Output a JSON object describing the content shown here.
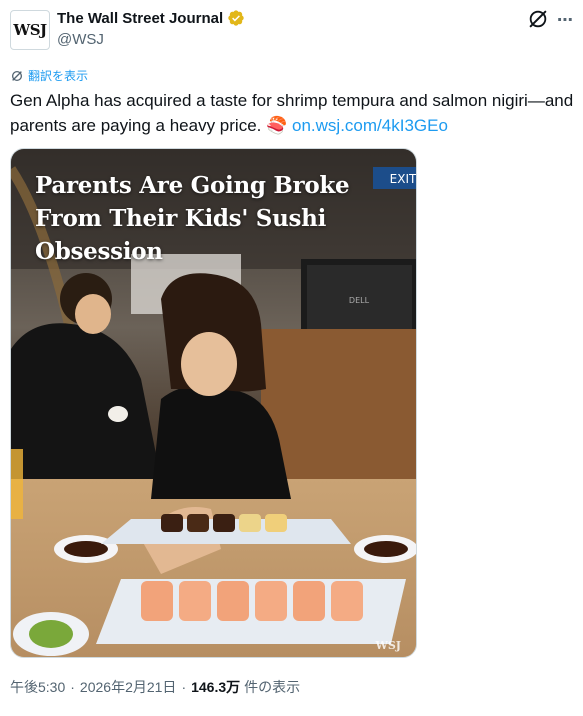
{
  "account": {
    "avatar_text": "WSJ",
    "display_name": "The Wall Street Journal",
    "handle": "@WSJ",
    "verified_color": "#e2b719"
  },
  "actions": {
    "grok_icon": "grok-icon",
    "more_icon": "more-icon",
    "more_glyph": "⋯"
  },
  "translate": {
    "label": "翻訳を表示",
    "icon": "translate-icon"
  },
  "tweet": {
    "text": "Gen Alpha has acquired a taste for shrimp tempura and salmon nigiri—and parents are paying a heavy price.",
    "emoji": "🍣",
    "link": "on.wsj.com/4kI3GEo"
  },
  "media": {
    "headline": "Parents Are Going Broke From Their Kids' Sushi Obsession",
    "exit_sign": "EXIT",
    "watermark": "WSJ",
    "monitor_brand": "DELL"
  },
  "meta": {
    "time": "午後5:30",
    "separator": "·",
    "date": "2026年2月21日",
    "views_count": "146.3万",
    "views_label": "件の表示"
  },
  "colors": {
    "link": "#1d9bf0",
    "muted": "#536471",
    "text": "#0f1419"
  }
}
